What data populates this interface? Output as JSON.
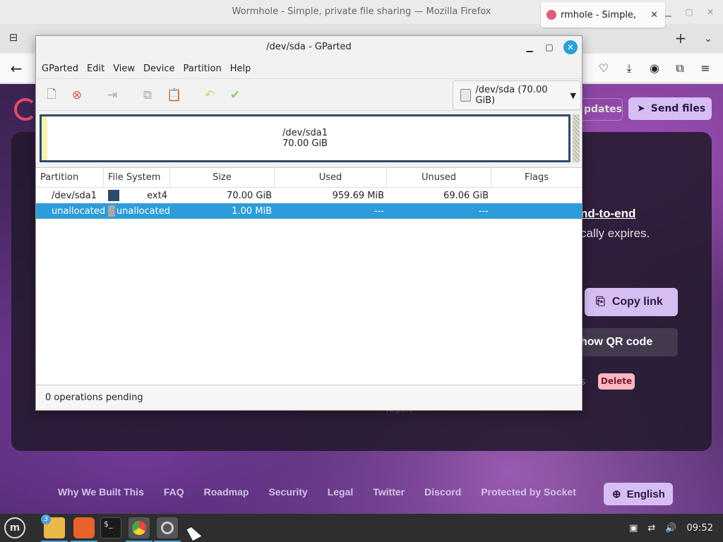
{
  "firefox": {
    "window_title": "Wormhole - Simple, private file sharing — Mozilla Firefox",
    "tab_title": "Wormhole - Simple, private file sharing",
    "tab_label_visible": "rmhole - Simple, ",
    "newtab": "+",
    "tabmenu": "⌄",
    "back": "←"
  },
  "page": {
    "updates_label": "pdates",
    "send_files_label": "Send files",
    "headline_fragment": "nd-to-end",
    "subline_fragment": "cally expires.",
    "copy_link_label": "Copy link",
    "qr_label": "how QR code",
    "dim_fragment": "s",
    "delete_label": "Delete",
    "report_label": "Report",
    "footer_links": [
      "Why We Built This",
      "FAQ",
      "Roadmap",
      "Security",
      "Legal",
      "Twitter",
      "Discord",
      "Protected by Socket"
    ],
    "language_label": "English"
  },
  "gparted": {
    "title": "/dev/sda - GParted",
    "menu": [
      "GParted",
      "Edit",
      "View",
      "Device",
      "Partition",
      "Help"
    ],
    "device": "/dev/sda (70.00 GiB)",
    "map_partition_name": "/dev/sda1",
    "map_partition_size": "70.00 GiB",
    "columns": [
      "Partition",
      "File System",
      "Size",
      "Used",
      "Unused",
      "Flags"
    ],
    "rows": [
      {
        "partition": "/dev/sda1",
        "fs": "ext4",
        "size": "70.00 GiB",
        "used": "959.69 MiB",
        "unused": "69.06 GiB",
        "flags": "",
        "fs_color": "#2e4a6b",
        "selected": false
      },
      {
        "partition": "unallocated",
        "fs": "unallocated",
        "size": "1.00 MiB",
        "used": "---",
        "unused": "---",
        "flags": "",
        "fs_color": "#a8a8a8",
        "selected": true
      }
    ],
    "status": "0 operations pending"
  },
  "taskbar": {
    "files_badge": "3",
    "clock": "09:52"
  },
  "colors": {
    "accent": "#2d9cd8",
    "button_purple": "#d6bef3"
  }
}
